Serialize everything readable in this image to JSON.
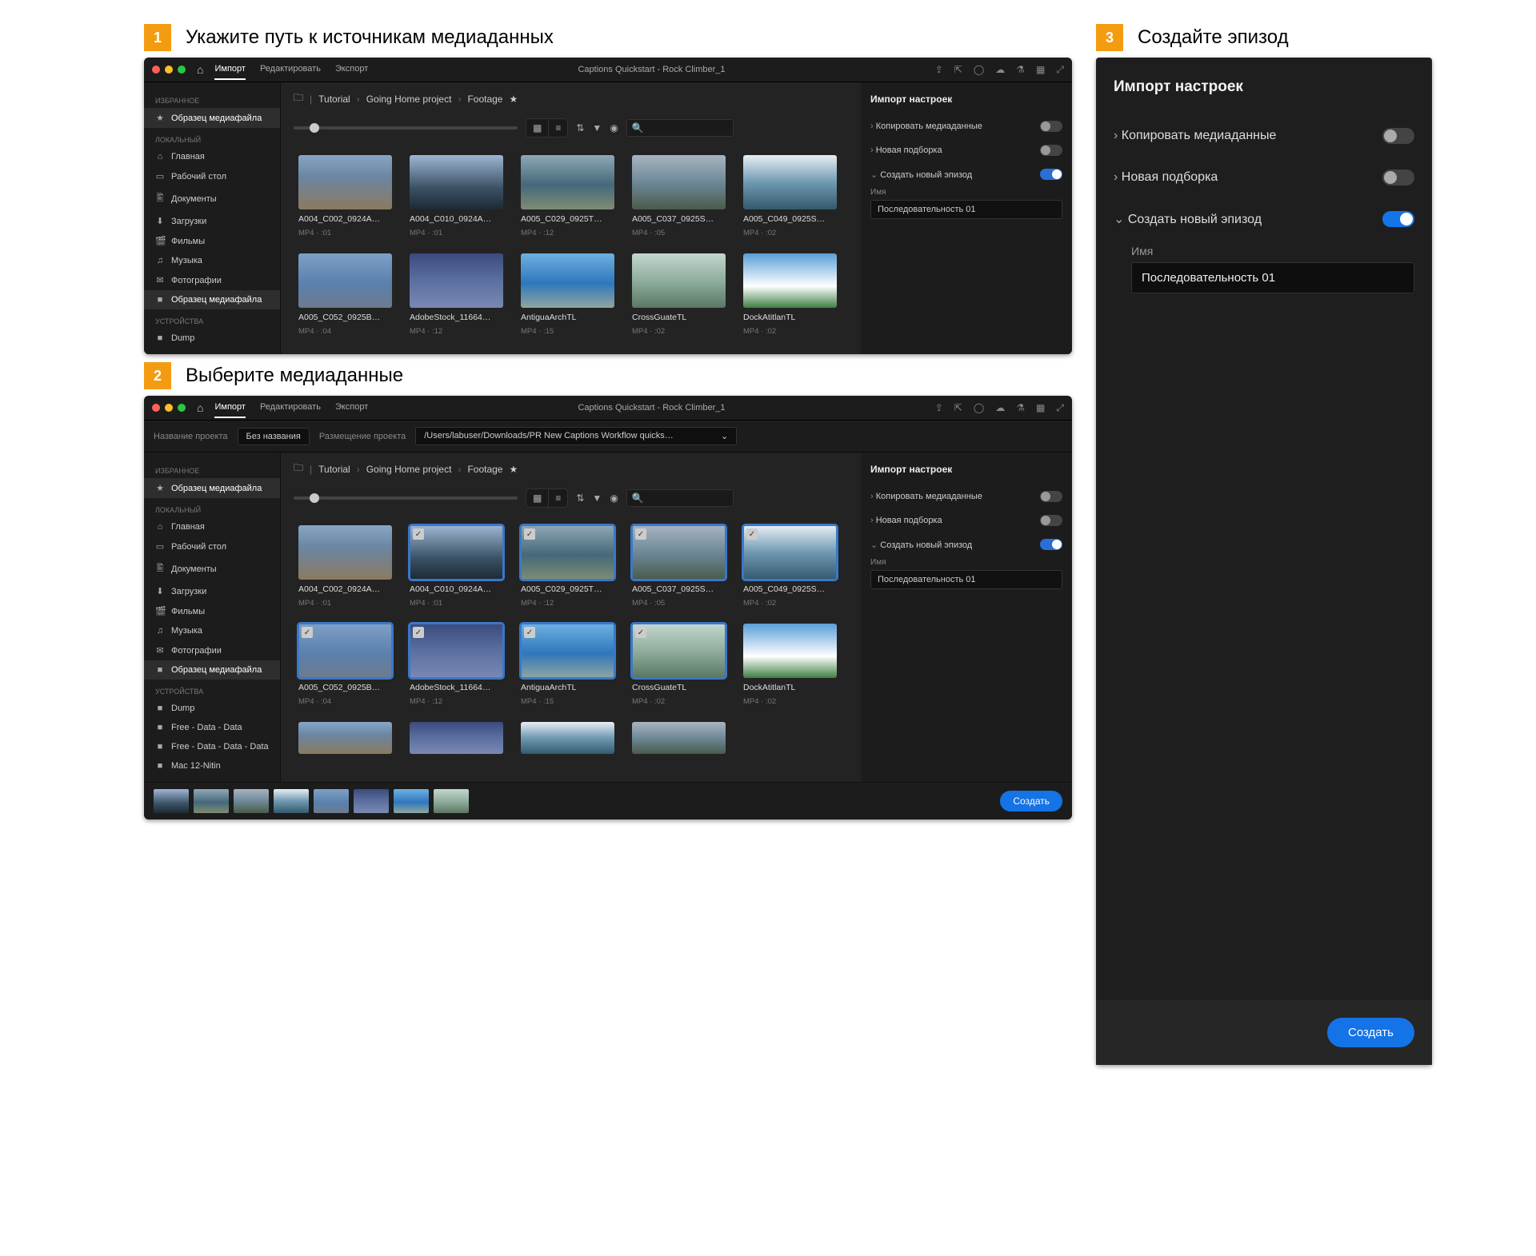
{
  "steps": {
    "s1": {
      "num": "1",
      "title": "Укажите путь к источникам медиаданных"
    },
    "s2": {
      "num": "2",
      "title": "Выберите медиаданные"
    },
    "s3": {
      "num": "3",
      "title": "Создайте эпизод"
    }
  },
  "topbar": {
    "tabs": {
      "import": "Импорт",
      "edit": "Редактировать",
      "export": "Экспорт"
    },
    "window_title": "Captions Quickstart - Rock Climber_1"
  },
  "project_row": {
    "name_label": "Название проекта",
    "name_value": "Без названия",
    "path_label": "Размещение проекта",
    "path_value": "/Users/labuser/Downloads/PR New Captions Workflow quicks…"
  },
  "sidebar": {
    "sections": {
      "fav": "ИЗБРАННОЕ",
      "local": "ЛОКАЛЬНЫЙ",
      "dev": "УСТРОЙСТВА"
    },
    "fav_item": "Образец медиафайла",
    "local_items": [
      {
        "icon": "⌂",
        "label": "Главная"
      },
      {
        "icon": "▭",
        "label": "Рабочий стол"
      },
      {
        "icon": "🖺",
        "label": "Документы"
      },
      {
        "icon": "⬇",
        "label": "Загрузки"
      },
      {
        "icon": "🎬",
        "label": "Фильмы"
      },
      {
        "icon": "♫",
        "label": "Музыка"
      },
      {
        "icon": "✉",
        "label": "Фотографии"
      },
      {
        "icon": "■",
        "label": "Образец медиафайла"
      }
    ],
    "dev_items_s1": [
      {
        "icon": "■",
        "label": "Dump"
      }
    ],
    "dev_items_s2": [
      {
        "icon": "■",
        "label": "Dump"
      },
      {
        "icon": "■",
        "label": "Free - Data - Data"
      },
      {
        "icon": "■",
        "label": "Free - Data - Data - Data"
      },
      {
        "icon": "■",
        "label": "Mac 12-Nitin"
      }
    ]
  },
  "breadcrumb": {
    "parts": [
      "Tutorial",
      "Going Home project",
      "Footage"
    ]
  },
  "search": {
    "placeholder": "Q"
  },
  "clips": [
    {
      "name": "A004_C002_0924A…",
      "meta": "MP4 · :01",
      "g": "g1"
    },
    {
      "name": "A004_C010_0924A…",
      "meta": "MP4 · :01",
      "g": "g2"
    },
    {
      "name": "A005_C029_0925T…",
      "meta": "MP4 · :12",
      "g": "g3"
    },
    {
      "name": "A005_C037_0925S…",
      "meta": "MP4 · :05",
      "g": "g4"
    },
    {
      "name": "A005_C049_0925S…",
      "meta": "MP4 · :02",
      "g": "g5"
    },
    {
      "name": "A005_C052_0925B…",
      "meta": "MP4 · :04",
      "g": "g6"
    },
    {
      "name": "AdobeStock_11664…",
      "meta": "MP4 · :12",
      "g": "g7"
    },
    {
      "name": "AntiguaArchTL",
      "meta": "MP4 · :15",
      "g": "g8"
    },
    {
      "name": "CrossGuateTL",
      "meta": "MP4 · :02",
      "g": "g9"
    },
    {
      "name": "DockAtitlanTL",
      "meta": "MP4 · :02",
      "g": "g10"
    }
  ],
  "clips_s2_select": [
    1,
    2,
    3,
    4,
    5,
    6,
    7,
    8
  ],
  "import_panel": {
    "title": "Импорт настроек",
    "copy": "Копировать медиаданные",
    "newbin": "Новая подборка",
    "newseq": "Создать новый эпизод",
    "name_label": "Имя",
    "name_value": "Последовательность 01"
  },
  "tray_create": "Создать",
  "bigpanel_create": "Создать"
}
